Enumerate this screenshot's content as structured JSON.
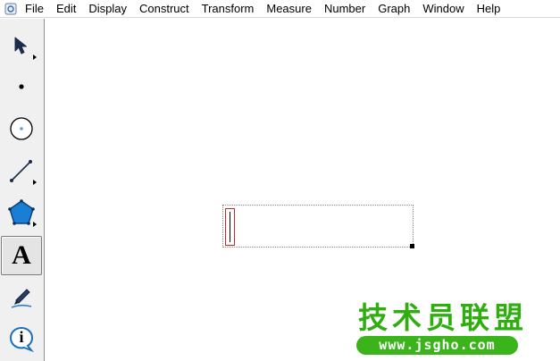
{
  "menu": {
    "items": [
      "File",
      "Edit",
      "Display",
      "Construct",
      "Transform",
      "Measure",
      "Number",
      "Graph",
      "Window",
      "Help"
    ]
  },
  "toolbox": {
    "tools": [
      {
        "icon": "arrow-select-icon",
        "has_submenu": true
      },
      {
        "icon": "point-icon",
        "has_submenu": false
      },
      {
        "icon": "compass-icon",
        "has_submenu": false
      },
      {
        "icon": "straightedge-icon",
        "has_submenu": true
      },
      {
        "icon": "polygon-icon",
        "has_submenu": true
      },
      {
        "icon": "text-icon",
        "label": "A",
        "has_submenu": false,
        "active": true
      },
      {
        "icon": "marker-icon",
        "has_submenu": false
      },
      {
        "icon": "information-icon",
        "label": "i",
        "has_submenu": false
      }
    ]
  },
  "canvas": {
    "text_box": {
      "value": ""
    }
  },
  "watermark": {
    "chars": [
      "技",
      "术",
      "员",
      "联",
      "盟"
    ],
    "url": "www.jsgho.com"
  },
  "colors": {
    "watermark_green": "#2fae10",
    "polygon_blue": "#1a7fd4",
    "caret_red": "#b03030"
  }
}
